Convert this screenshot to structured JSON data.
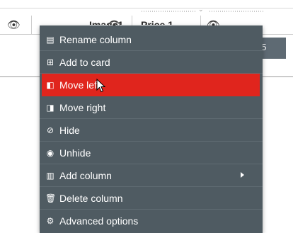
{
  "table": {
    "columns": [
      {
        "title": "Image1",
        "eye_icon": "eye-icon"
      },
      {
        "title": "Price 1",
        "eye_icon": "eye-icon"
      },
      {
        "title": "",
        "eye_icon": "eye-icon"
      }
    ],
    "selected_cell_value": "05",
    "colors": {
      "selected_cell": "#5e6a73"
    }
  },
  "context_menu": {
    "colors": {
      "background": "#4f5b62",
      "active": "#e0251d",
      "text": "#ffffff"
    },
    "items": [
      {
        "label": "Rename column",
        "icon": "rename-icon"
      },
      {
        "label": "Add to card",
        "icon": "add-to-card-icon"
      },
      {
        "label": "Move left",
        "icon": "move-left-icon",
        "active": true
      },
      {
        "label": "Move right",
        "icon": "move-right-icon"
      },
      {
        "label": "Hide",
        "icon": "hide-icon"
      },
      {
        "label": "Unhide",
        "icon": "unhide-icon"
      },
      {
        "label": "Add column",
        "icon": "add-column-icon",
        "has_submenu": true
      },
      {
        "label": "Delete column",
        "icon": "trash-icon"
      },
      {
        "label": "Advanced options",
        "icon": "gear-icon"
      }
    ]
  }
}
